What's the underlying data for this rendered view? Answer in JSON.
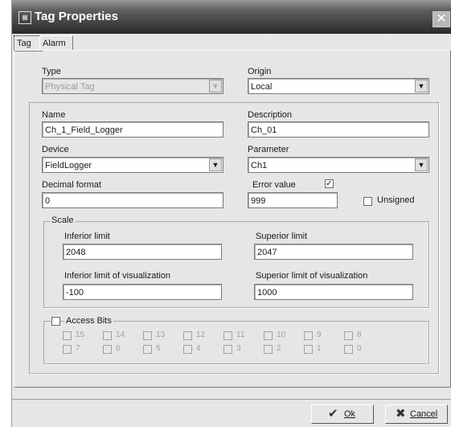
{
  "window": {
    "title": "Tag Properties",
    "icon": "tag-properties-icon",
    "close_glyph": "✕"
  },
  "tabs": [
    {
      "label": "Tag",
      "active": true
    },
    {
      "label": "Alarm",
      "active": false
    }
  ],
  "type": {
    "label": "Type",
    "value": "Physical Tag",
    "enabled": false
  },
  "origin": {
    "label": "Origin",
    "value": "Local"
  },
  "name": {
    "label": "Name",
    "value": "Ch_1_Field_Logger"
  },
  "description": {
    "label": "Description",
    "value": "Ch_01"
  },
  "device": {
    "label": "Device",
    "value": "FieldLogger"
  },
  "parameter": {
    "label": "Parameter",
    "value": "Ch1"
  },
  "decimal_format": {
    "label": "Decimal format",
    "value": "0"
  },
  "error_value": {
    "label": "Error value",
    "value": "999",
    "checked": true
  },
  "unsigned": {
    "label": "Unsigned",
    "checked": false
  },
  "scale": {
    "label": "Scale",
    "inferior_limit": {
      "label": "Inferior limit",
      "value": "2048"
    },
    "superior_limit": {
      "label": "Superior limit",
      "value": "2047"
    },
    "inferior_vis": {
      "label": "Inferior limit of visualization",
      "value": "-100"
    },
    "superior_vis": {
      "label": "Superior limit of visualization",
      "value": "1000"
    }
  },
  "access_bits": {
    "label": "Access Bits",
    "checked": false,
    "row1": [
      "15",
      "14",
      "13",
      "12",
      "11",
      "10",
      "9",
      "8"
    ],
    "row2": [
      "7",
      "6",
      "5",
      "4",
      "3",
      "2",
      "1",
      "0"
    ]
  },
  "buttons": {
    "ok": "Ok",
    "cancel": "Cancel"
  }
}
